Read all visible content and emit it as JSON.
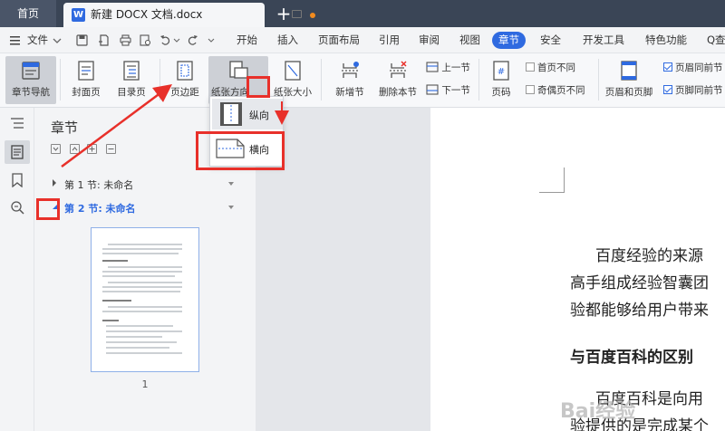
{
  "tabbar": {
    "home_label": "首页",
    "doc_title": "新建 DOCX 文档.docx",
    "doc_badge": "W",
    "add_label": "+"
  },
  "menubar": {
    "file_label": "文件",
    "items": [
      "开始",
      "插入",
      "页面布局",
      "引用",
      "审阅",
      "视图",
      "章节",
      "安全",
      "开发工具",
      "特色功能"
    ],
    "active_item": "章节",
    "search_label": "Q查找"
  },
  "ribbon": {
    "section_nav": "章节导航",
    "cover_page": "封面页",
    "toc_page": "目录页",
    "margins": "页边距",
    "orientation": "纸张方向",
    "paper_size": "纸张大小",
    "new_section": "新增节",
    "delete_section": "删除本节",
    "prev_section": "上一节",
    "next_section": "下一节",
    "page_number": "页码",
    "first_page_diff": "首页不同",
    "odd_even_diff": "奇偶页不同",
    "header_footer": "页眉和页脚",
    "header_same_prev": "页眉同前节",
    "footer_same_prev": "页脚同前节"
  },
  "orientation_menu": {
    "portrait": "纵向",
    "landscape": "横向"
  },
  "nav_panel": {
    "title": "章节",
    "sections": [
      {
        "label": "第 1 节: 未命名",
        "expanded": false
      },
      {
        "label": "第 2 节: 未命名",
        "expanded": true
      }
    ],
    "thumbnail_page": "1"
  },
  "document": {
    "lines": [
      "百度经验的来源",
      "高手组成经验智囊团",
      "验都能够给用户带来",
      "与百度百科的区别",
      "百度百科是向用",
      "验提供的是完成某个"
    ]
  },
  "watermark": "Bai经验",
  "colors": {
    "accent": "#2f6ae0",
    "tabbar_bg": "#3a4556",
    "annotation_red": "#e8302a",
    "panel_bg": "#f3f4f6"
  }
}
